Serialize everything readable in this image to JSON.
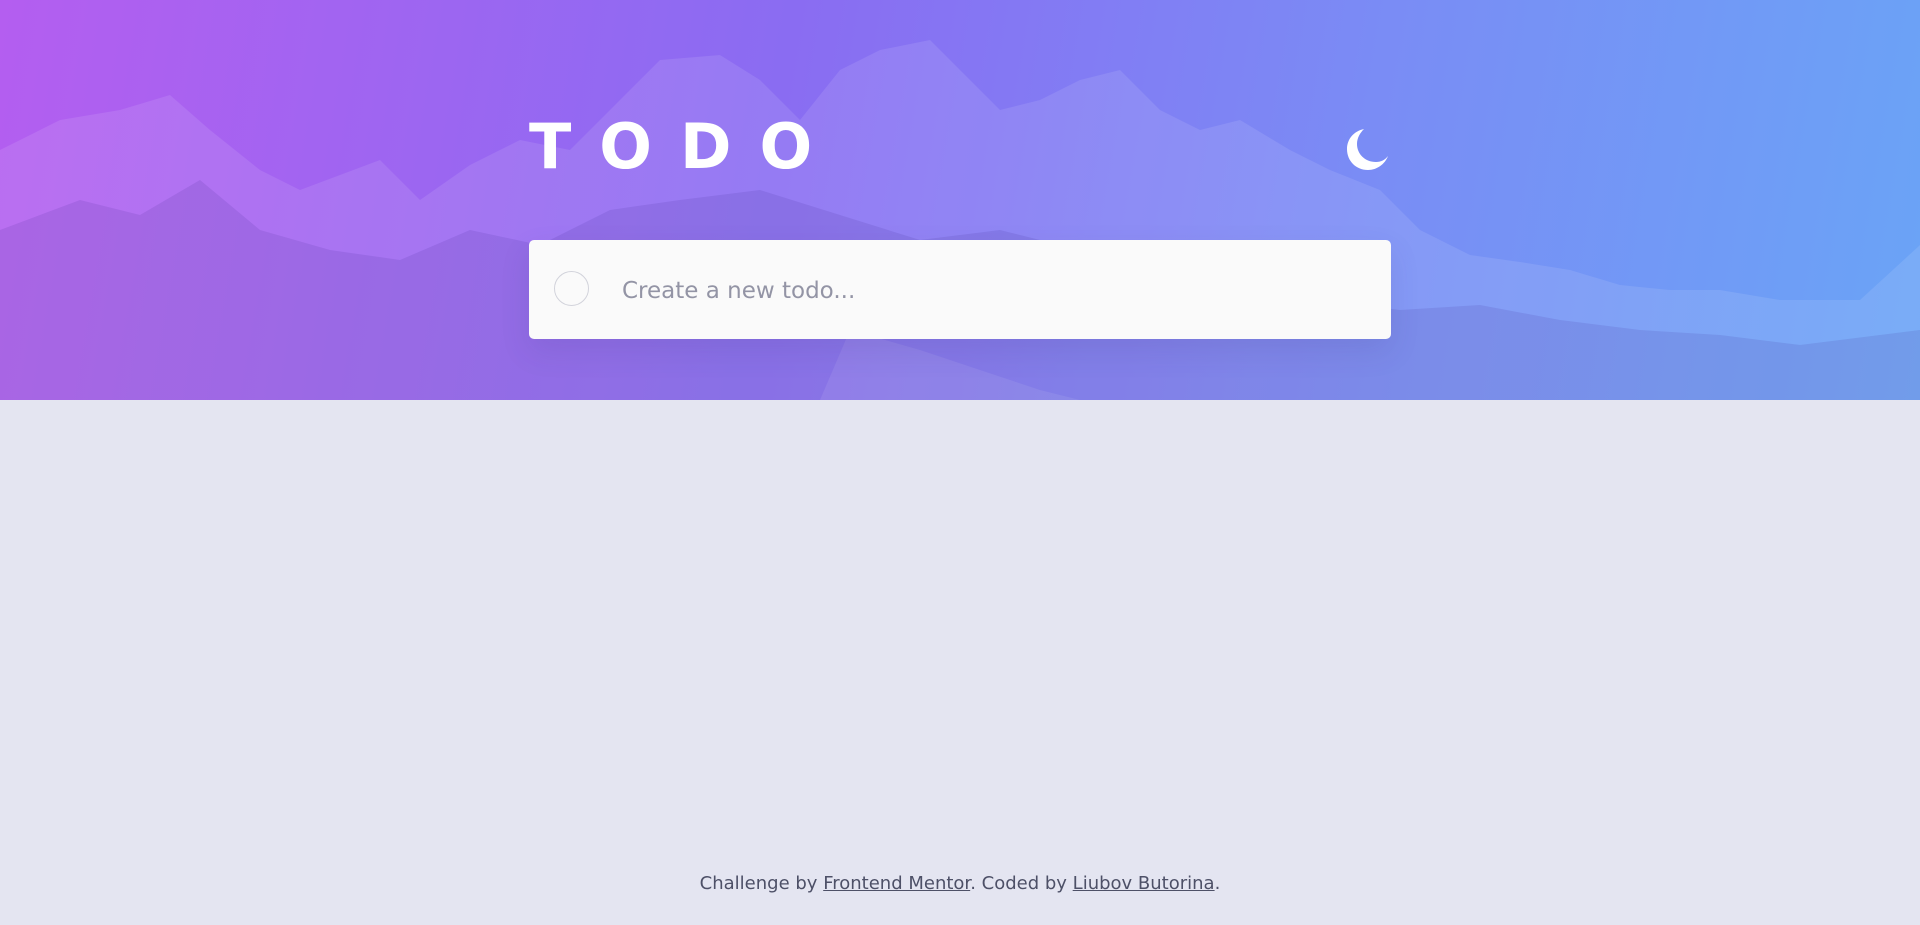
{
  "app": {
    "title": "TODO"
  },
  "theme_toggle": {
    "icon": "moon-icon"
  },
  "new_todo": {
    "placeholder": "Create a new todo..."
  },
  "footer": {
    "prefix": "Challenge by ",
    "link1_label": "Frontend Mentor",
    "middle": ". Coded by ",
    "link2_label": "Liubov Butorina",
    "suffix": "."
  },
  "colors": {
    "background": "#e4e5f1",
    "gradient_start": "#b45ef0",
    "gradient_end": "#6aa4f6",
    "card": "#fafafa",
    "placeholder": "#9394a5",
    "footer_text": "#4d5067"
  }
}
